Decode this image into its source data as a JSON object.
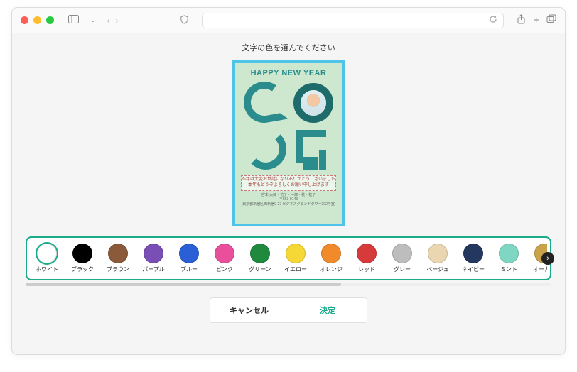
{
  "prompt": "文字の色を選んでください",
  "card": {
    "title": "HAPPY NEW YEAR",
    "greeting_line1": "昨年は大変お世話になりありがとうございました",
    "greeting_line2": "本年もどうぞよろしくお願い申し上げます",
    "sender_line1": "宮本 太郎・花子・一郎・桃・桃子",
    "sender_line2": "〒863-9143",
    "sender_line3": "東京都新宿区西新宿0-27 ビジネスグランドタワー202号室"
  },
  "colors": [
    {
      "name": "white",
      "label": "ホワイト",
      "hex": "#ffffff",
      "selected": true
    },
    {
      "name": "black",
      "label": "ブラック",
      "hex": "#000000"
    },
    {
      "name": "brown",
      "label": "ブラウン",
      "hex": "#8a5a3a"
    },
    {
      "name": "purple",
      "label": "パープル",
      "hex": "#7a4fb5"
    },
    {
      "name": "blue",
      "label": "ブルー",
      "hex": "#2a5fd6"
    },
    {
      "name": "pink",
      "label": "ピンク",
      "hex": "#e94f9b"
    },
    {
      "name": "green",
      "label": "グリーン",
      "hex": "#1f8a3e"
    },
    {
      "name": "yellow",
      "label": "イエロー",
      "hex": "#f5d735"
    },
    {
      "name": "orange",
      "label": "オレンジ",
      "hex": "#f08a2a"
    },
    {
      "name": "red",
      "label": "レッド",
      "hex": "#d63a3a"
    },
    {
      "name": "gray",
      "label": "グレー",
      "hex": "#bdbdbd"
    },
    {
      "name": "beige",
      "label": "ベージュ",
      "hex": "#ead6b0"
    },
    {
      "name": "navy",
      "label": "ネイビー",
      "hex": "#24375f"
    },
    {
      "name": "mint",
      "label": "ミント",
      "hex": "#7fd6c2"
    },
    {
      "name": "ocher",
      "label": "オーカー",
      "hex": "#c9a24a"
    }
  ],
  "actions": {
    "cancel": "キャンセル",
    "ok": "決定"
  },
  "accent": "#1aab8a",
  "card_border": "#4fc3e8"
}
